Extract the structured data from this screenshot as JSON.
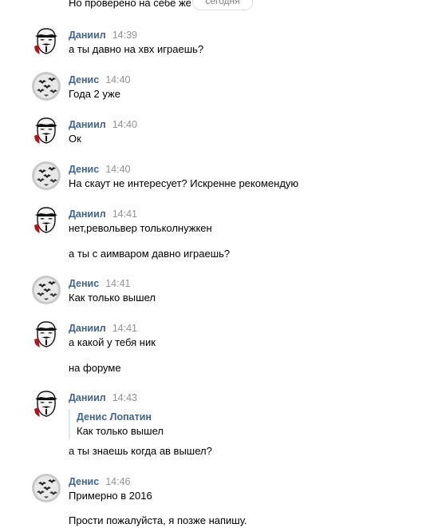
{
  "top_message": "Но проверено на себе же",
  "date_separator": "сегодня",
  "users": {
    "daniil": {
      "name": "Даниил",
      "avatar_icon": "guy-fawkes-mask-icon"
    },
    "denis": {
      "name": "Денис",
      "avatar_icon": "bats-moon-icon"
    }
  },
  "messages": [
    {
      "author": "Даниил",
      "time": "14:39",
      "lines": [
        "а ты давно на хвх играешь?"
      ]
    },
    {
      "author": "Денис",
      "time": "14:40",
      "lines": [
        "Года 2 уже"
      ]
    },
    {
      "author": "Даниил",
      "time": "14:40",
      "lines": [
        "Ок"
      ]
    },
    {
      "author": "Денис",
      "time": "14:40",
      "lines": [
        "На скаут не интересует? Искренне рекомендую"
      ]
    },
    {
      "author": "Даниил",
      "time": "14:41",
      "lines": [
        "нет,револьвер тольколнужкен",
        "а ты с аимваром давно играешь?"
      ]
    },
    {
      "author": "Денис",
      "time": "14:41",
      "lines": [
        "Как только вышел"
      ]
    },
    {
      "author": "Даниил",
      "time": "14:41",
      "lines": [
        "а какой у тебя ник",
        "на форуме"
      ]
    },
    {
      "author": "Даниил",
      "time": "14:43",
      "quote": {
        "author": "Денис Лопатин",
        "text": "Как только вышел"
      },
      "lines": [
        "а ты знаешь когда ав вышел?"
      ]
    },
    {
      "author": "Денис",
      "time": "14:46",
      "lines": [
        "Примерно в 2016",
        "Прости пожалуйста, я позже напишу."
      ]
    }
  ]
}
